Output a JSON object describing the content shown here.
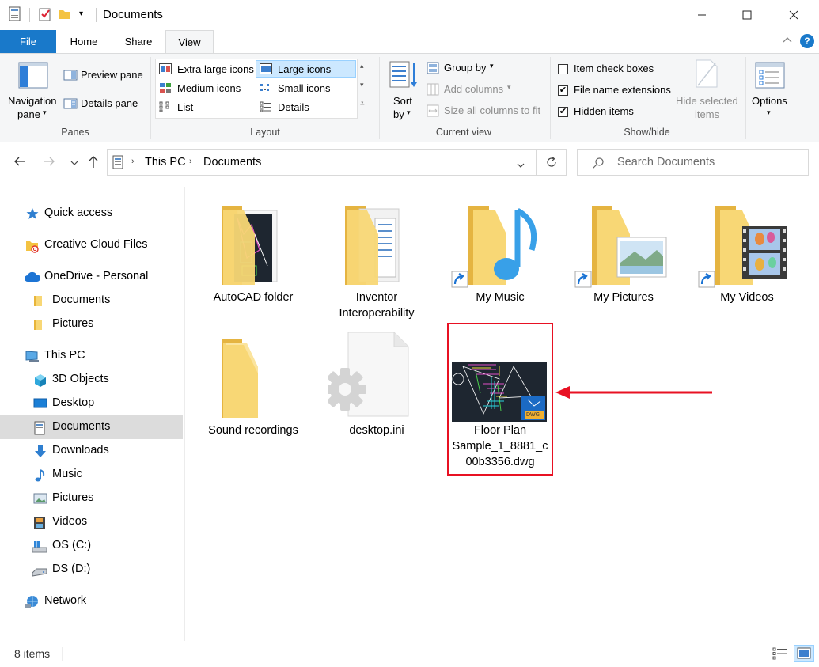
{
  "window": {
    "title": "Documents"
  },
  "ribbon": {
    "tabs": [
      {
        "label": "File"
      },
      {
        "label": "Home"
      },
      {
        "label": "Share"
      },
      {
        "label": "View"
      }
    ],
    "panes": {
      "navigation_pane": "Navigation",
      "navigation_pane2": "pane",
      "preview_pane": "Preview pane",
      "details_pane": "Details pane",
      "group_label": "Panes"
    },
    "layout": {
      "options": [
        "Extra large icons",
        "Large icons",
        "Medium icons",
        "Small icons",
        "List",
        "Details"
      ],
      "selected": "Large icons",
      "group_label": "Layout"
    },
    "current_view": {
      "sort": "Sort",
      "sort2": "by",
      "group_by": "Group by",
      "add_columns": "Add columns",
      "size_columns": "Size all columns to fit",
      "group_label": "Current view"
    },
    "show_hide": {
      "item_check_boxes": {
        "label": "Item check boxes",
        "checked": false
      },
      "file_name_extensions": {
        "label": "File name extensions",
        "checked": true
      },
      "hidden_items": {
        "label": "Hidden items",
        "checked": true
      },
      "hide_selected": "Hide selected",
      "hide_selected2": "items",
      "group_label": "Show/hide"
    },
    "options": "Options"
  },
  "address": {
    "breadcrumb": [
      "This PC",
      "Documents"
    ],
    "search_placeholder": "Search Documents"
  },
  "nav": {
    "quick_access": "Quick access",
    "creative_cloud": "Creative Cloud Files",
    "onedrive": "OneDrive - Personal",
    "onedrive_documents": "Documents",
    "onedrive_pictures": "Pictures",
    "this_pc": "This PC",
    "objects_3d": "3D Objects",
    "desktop": "Desktop",
    "documents": "Documents",
    "downloads": "Downloads",
    "music": "Music",
    "pictures": "Pictures",
    "videos": "Videos",
    "os_c": "OS (C:)",
    "ds_d": "DS (D:)",
    "network": "Network"
  },
  "files": {
    "autocad": "AutoCAD folder",
    "inventor1": "Inventor",
    "inventor2": "Interoperability",
    "my_music": "My Music",
    "my_pictures": "My Pictures",
    "my_videos": "My Videos",
    "sound": "Sound recordings",
    "desktop_ini": "desktop.ini",
    "floor1": "Floor Plan",
    "floor2": "Sample_1_8881_c",
    "floor3": "00b3356.dwg",
    "dwg_badge": "DWG"
  },
  "status": {
    "count": "8 items"
  },
  "colors": {
    "accent": "#1979ca",
    "highlight": "#e81123",
    "folder": "#f8d775",
    "folder_dark": "#e8b53a"
  }
}
